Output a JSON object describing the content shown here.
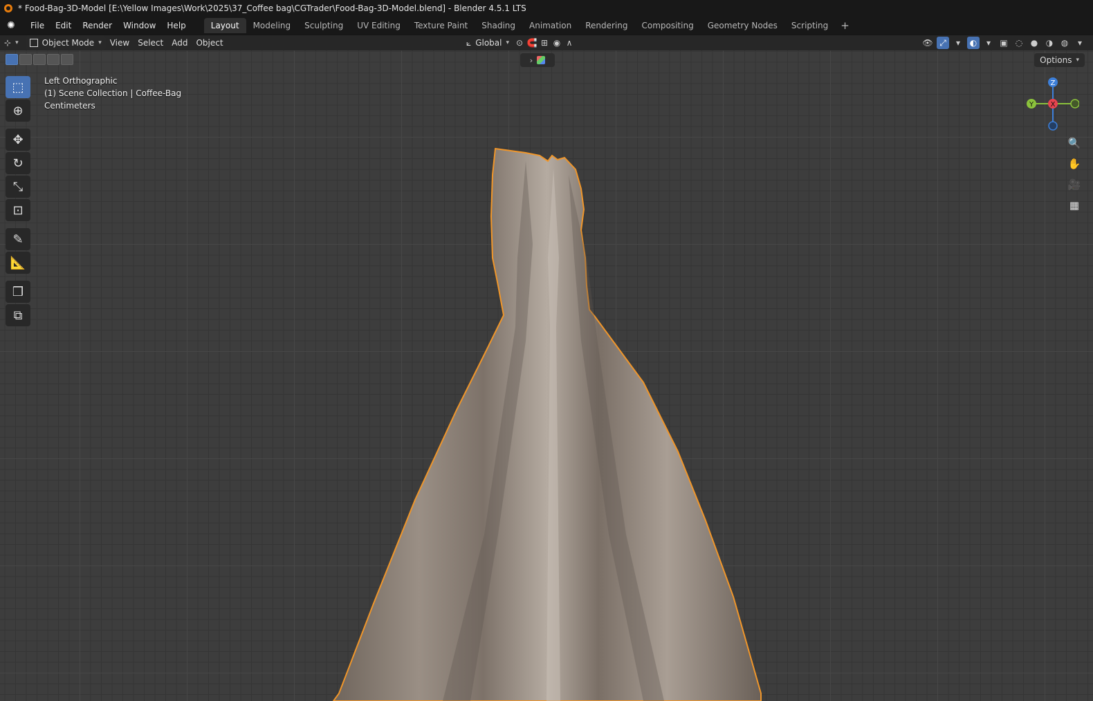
{
  "title": "* Food-Bag-3D-Model [E:\\Yellow Images\\Work\\2025\\37_Coffee bag\\CGTrader\\Food-Bag-3D-Model.blend] - Blender 4.5.1 LTS",
  "menu": [
    "File",
    "Edit",
    "Render",
    "Window",
    "Help"
  ],
  "workspaces": [
    "Layout",
    "Modeling",
    "Sculpting",
    "UV Editing",
    "Texture Paint",
    "Shading",
    "Animation",
    "Rendering",
    "Compositing",
    "Geometry Nodes",
    "Scripting"
  ],
  "header": {
    "mode": "Object Mode",
    "menus": [
      "View",
      "Select",
      "Add",
      "Object"
    ],
    "orientation": "Global"
  },
  "viewport": {
    "view_name": "Left Orthographic",
    "collection": "(1) Scene Collection | Coffee-Bag",
    "units": "Centimeters",
    "options_label": "Options"
  },
  "gizmo": {
    "z": "Z",
    "y": "Y",
    "x": "X"
  },
  "colors": {
    "accent": "#4772b3",
    "selection_outline": "#f0962a",
    "x_axis": "#e8434f",
    "y_axis": "#8bc23c",
    "z_axis": "#3d7fd9"
  }
}
